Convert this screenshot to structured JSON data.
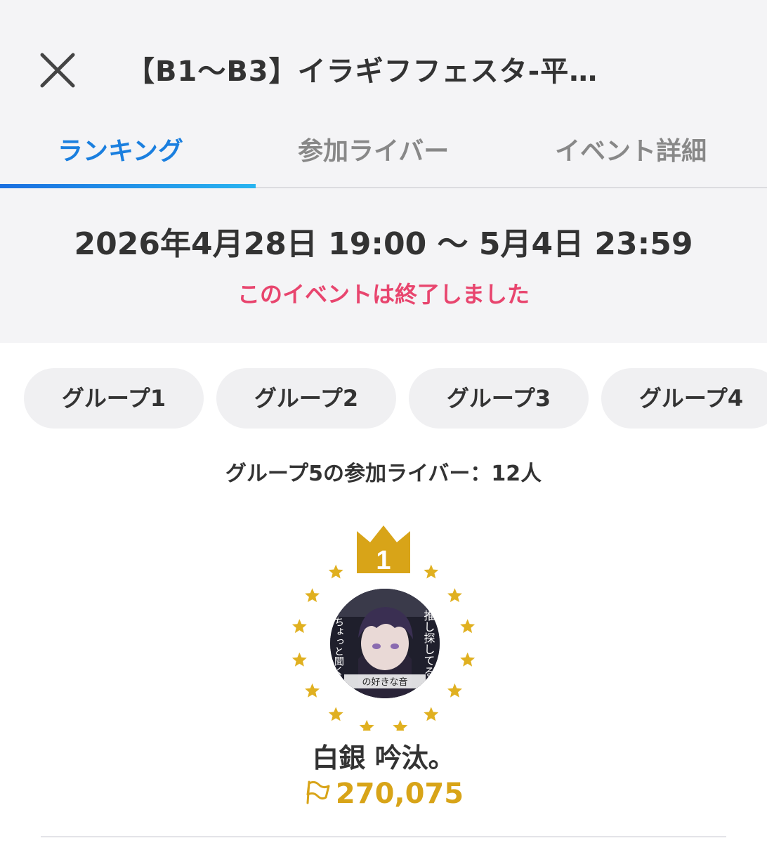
{
  "header": {
    "title": "【B1〜B3】イラギフフェスタ-平…",
    "close_icon": "close-icon"
  },
  "tabs": [
    {
      "label": "ランキング",
      "active": true
    },
    {
      "label": "参加ライバー",
      "active": false
    },
    {
      "label": "イベント詳細",
      "active": false
    }
  ],
  "event": {
    "period": "2026年4月28日 19:00 〜 5月4日 23:59",
    "status": "このイベントは終了しました"
  },
  "groups": [
    {
      "label": "グループ1"
    },
    {
      "label": "グループ2"
    },
    {
      "label": "グループ3"
    },
    {
      "label": "グループ4"
    }
  ],
  "participants_text": "グループ5の参加ライバー：12人",
  "winner": {
    "rank": "1",
    "name": "白銀 吟汰。",
    "score": "270,075",
    "avatar_texts": [
      "推し探してる",
      "ちょっと聞く",
      "の好きな音"
    ]
  },
  "colors": {
    "accent": "#1a7fdf",
    "ended": "#e8456e",
    "gold": "#d8a418",
    "background_top": "#f4f4f6"
  }
}
